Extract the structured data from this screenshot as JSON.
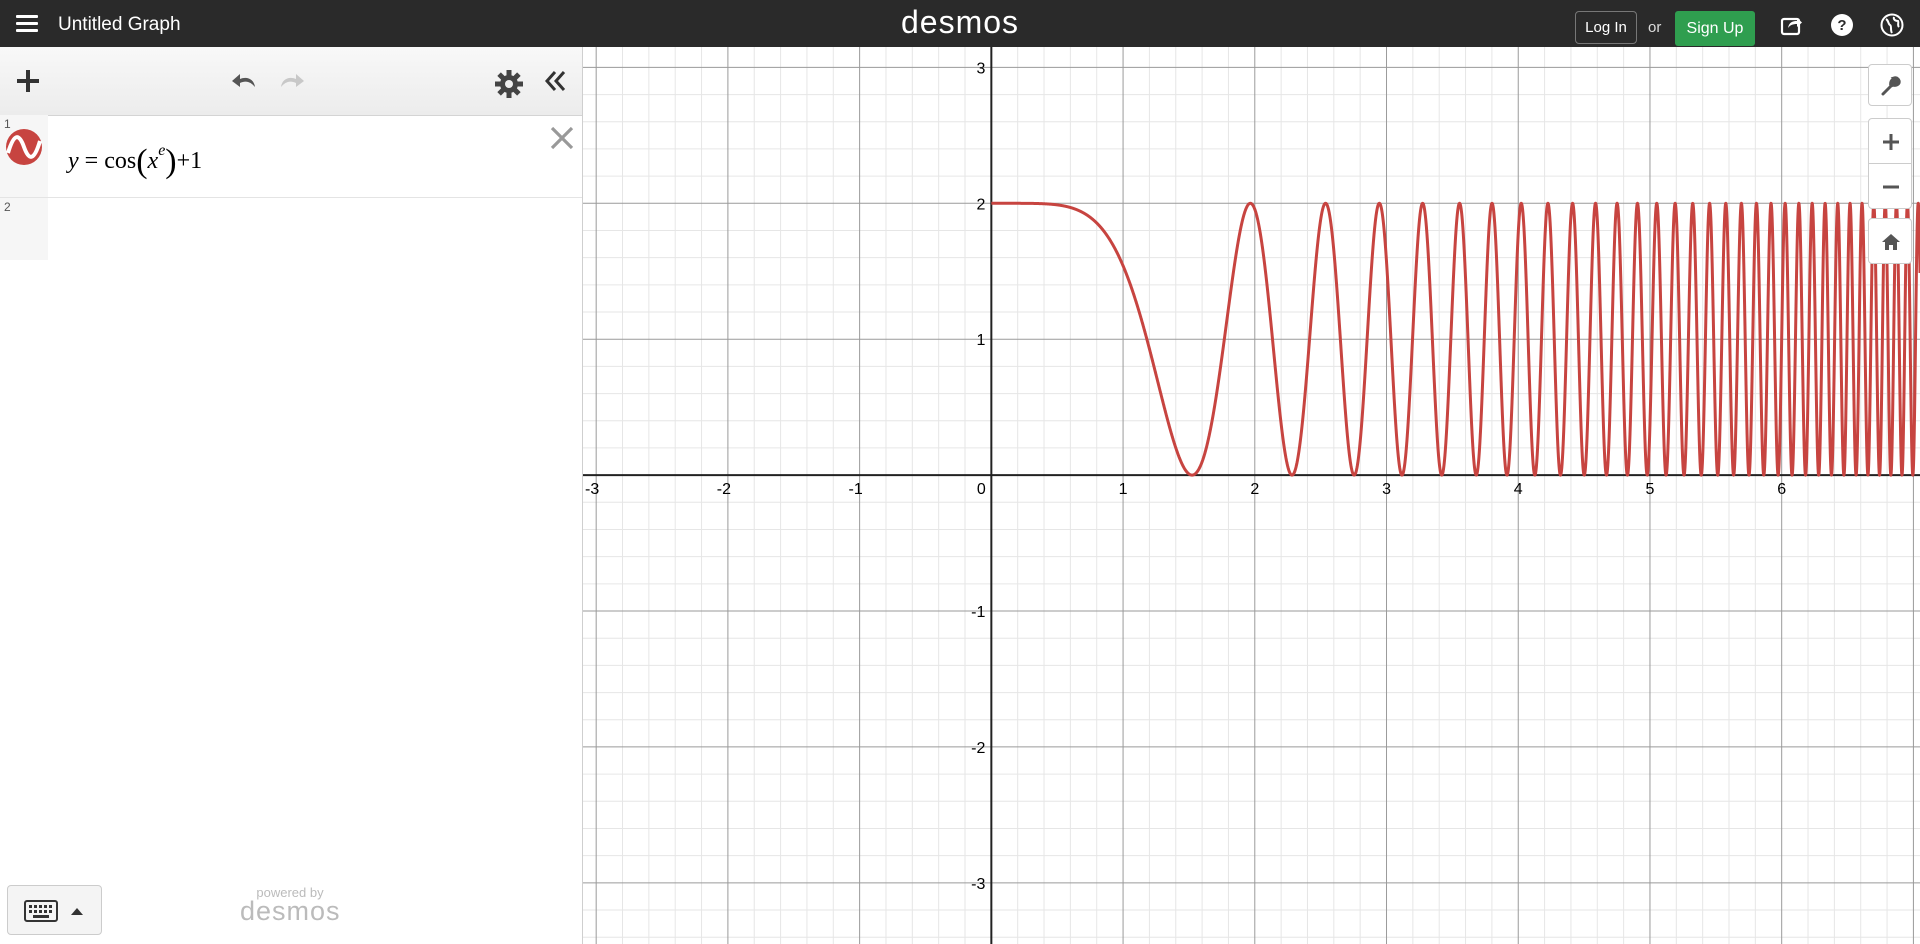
{
  "header": {
    "title": "Untitled Graph",
    "logo": "desmos",
    "login_label": "Log In",
    "or_text": "or",
    "signup_label": "Sign Up"
  },
  "expressions": [
    {
      "number": "1",
      "latex": "y = cos(x^e) + 1",
      "parts": {
        "lhs": "y",
        "eq": "=",
        "fn": "cos",
        "base": "x",
        "exp": "e",
        "tail": "+1"
      },
      "color": "#c74440"
    },
    {
      "number": "2",
      "latex": ""
    }
  ],
  "footer": {
    "powered_by": "powered by",
    "brand": "desmos"
  },
  "graph": {
    "x_tick_labels": [
      "-3",
      "-2",
      "-1",
      "0",
      "1",
      "2",
      "3",
      "4",
      "5",
      "6"
    ],
    "y_tick_labels": [
      "3",
      "2",
      "1",
      "-1",
      "-2",
      "-3"
    ],
    "x_range": [
      -3.1,
      7.05
    ],
    "y_range": [
      -3.45,
      3.15
    ],
    "curve_color": "#c74440",
    "grid": true
  },
  "chart_data": {
    "type": "line",
    "function": "cos(x^e)+1",
    "domain": [
      0,
      7.05
    ],
    "xlim": [
      -3.1,
      7.05
    ],
    "ylim": [
      -3.45,
      3.15
    ],
    "series": [
      {
        "color": "#c74440"
      }
    ]
  },
  "colors": {
    "header_bg": "#2a2a2a",
    "signup_bg": "#2f9e4f",
    "curve": "#c74440"
  }
}
